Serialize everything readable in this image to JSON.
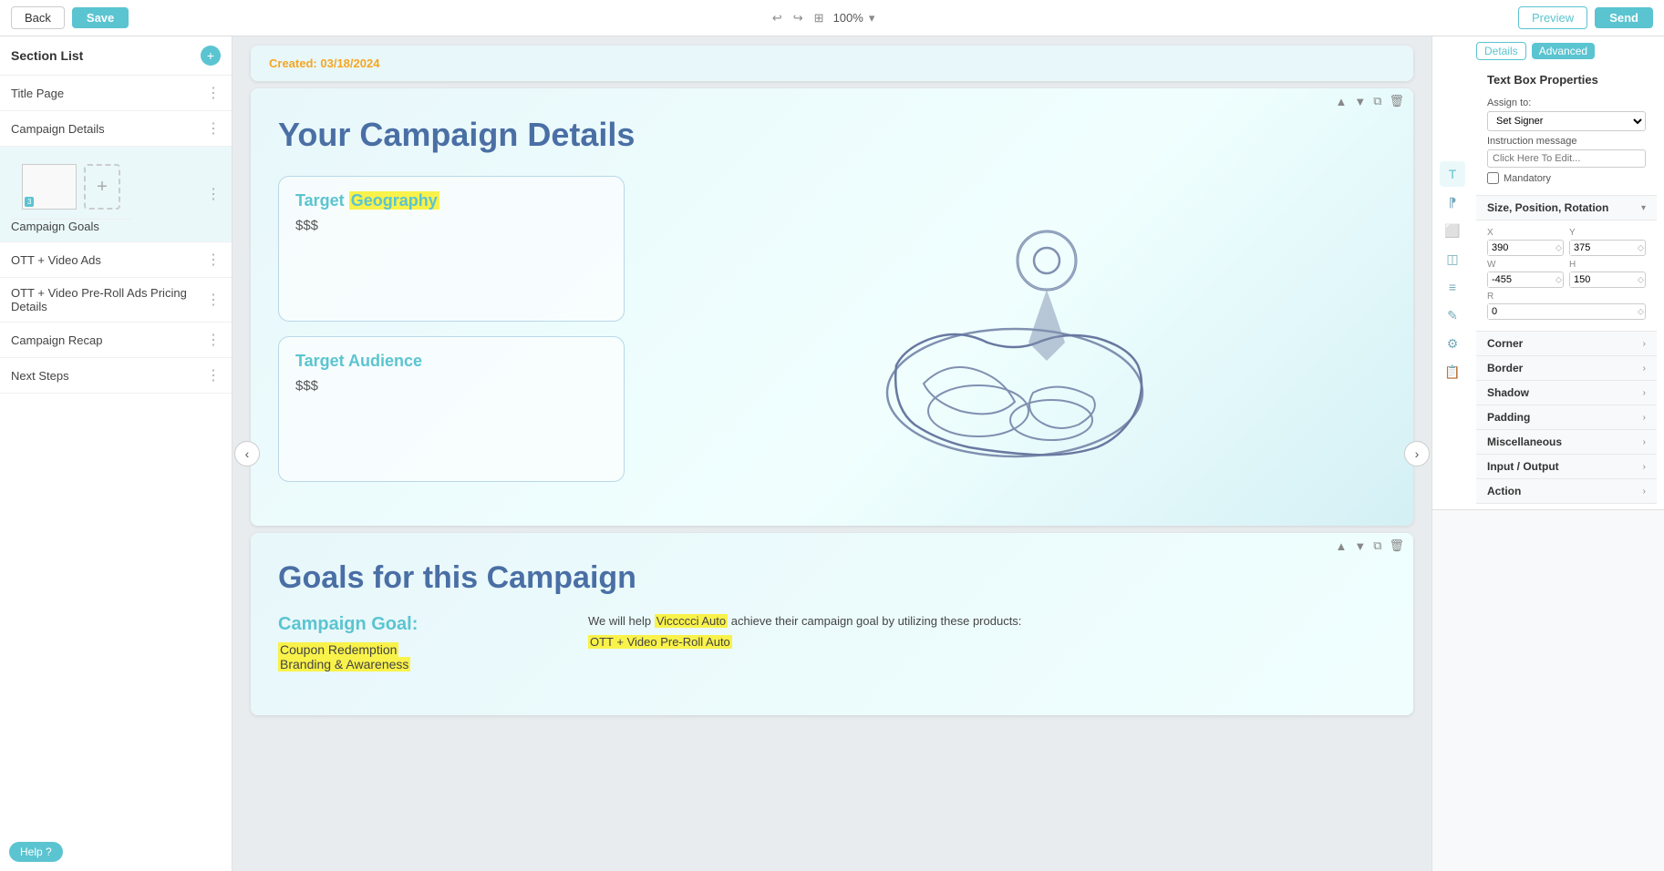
{
  "toolbar": {
    "back_label": "Back",
    "save_label": "Save",
    "preview_label": "Preview",
    "send_label": "Send",
    "zoom": "100%",
    "zoom_chevron": "▾"
  },
  "sidebar": {
    "title": "Section List",
    "add_title": "+",
    "items": [
      {
        "id": "title-page",
        "label": "Title Page"
      },
      {
        "id": "campaign-details",
        "label": "Campaign Details"
      },
      {
        "id": "campaign-goals",
        "label": "Campaign Goals",
        "active": true
      },
      {
        "id": "ott-video-ads",
        "label": "OTT + Video Ads"
      },
      {
        "id": "ott-video-pre-roll",
        "label": "OTT + Video Pre-Roll Ads Pricing Details"
      },
      {
        "id": "campaign-recap",
        "label": "Campaign Recap"
      },
      {
        "id": "next-steps",
        "label": "Next Steps"
      }
    ],
    "thumb_num": "3"
  },
  "slides": {
    "created_label": "Created:",
    "created_date": "03/18/2024",
    "campaign_details_title": "Your Campaign Details",
    "target_geography_label": "Target",
    "target_geography_highlight": "Geography",
    "target_geography_value": "$$$",
    "target_audience_label": "Target Audience",
    "target_audience_value": "$$$",
    "goals_title": "Goals for this Campaign",
    "campaign_goal_label": "Campaign Goal:",
    "goal_items": [
      "Coupon Redemption",
      "Branding & Awareness"
    ],
    "goals_text_prefix": "We will help",
    "goals_highlight": "Viccccci Auto",
    "goals_text_suffix": "achieve their campaign goal by utilizing these products:",
    "goals_product": "OTT + Video Pre-Roll Auto"
  },
  "right_panel": {
    "tabs": {
      "details": "Details",
      "advanced": "Advanced"
    },
    "textbox_props_title": "Text Box Properties",
    "assign_to_label": "Assign to:",
    "assign_to_value": "Set Signer",
    "instruction_label": "Instruction message",
    "instruction_placeholder": "Click Here To Edit...",
    "mandatory_label": "Mandatory",
    "size_position_title": "Size, Position, Rotation",
    "x_label": "X",
    "x_value": "390",
    "y_label": "Y",
    "y_value": "375",
    "w_label": "W",
    "w_value": "-455",
    "h_label": "H",
    "h_value": "150",
    "r_label": "R",
    "r_value": "0",
    "sections": [
      {
        "id": "corner",
        "label": "Corner"
      },
      {
        "id": "border",
        "label": "Border"
      },
      {
        "id": "shadow",
        "label": "Shadow"
      },
      {
        "id": "padding",
        "label": "Padding"
      },
      {
        "id": "miscellaneous",
        "label": "Miscellaneous"
      },
      {
        "id": "input-output",
        "label": "Input / Output"
      },
      {
        "id": "action",
        "label": "Action"
      }
    ],
    "help_label": "Help ?"
  },
  "nav": {
    "left_arrow": "‹",
    "right_arrow": "›"
  },
  "icons": {
    "undo": "↩",
    "redo": "↪",
    "grid": "⊞",
    "chevron_down": "▾",
    "panel_icon_1": "T",
    "panel_icon_2": "A",
    "panel_icon_3": "⬜",
    "panel_icon_4": "◫",
    "panel_icon_5": "≡",
    "panel_icon_6": "✎",
    "panel_icon_7": "⚙",
    "panel_icon_8": "📋",
    "dots": "⋮"
  }
}
